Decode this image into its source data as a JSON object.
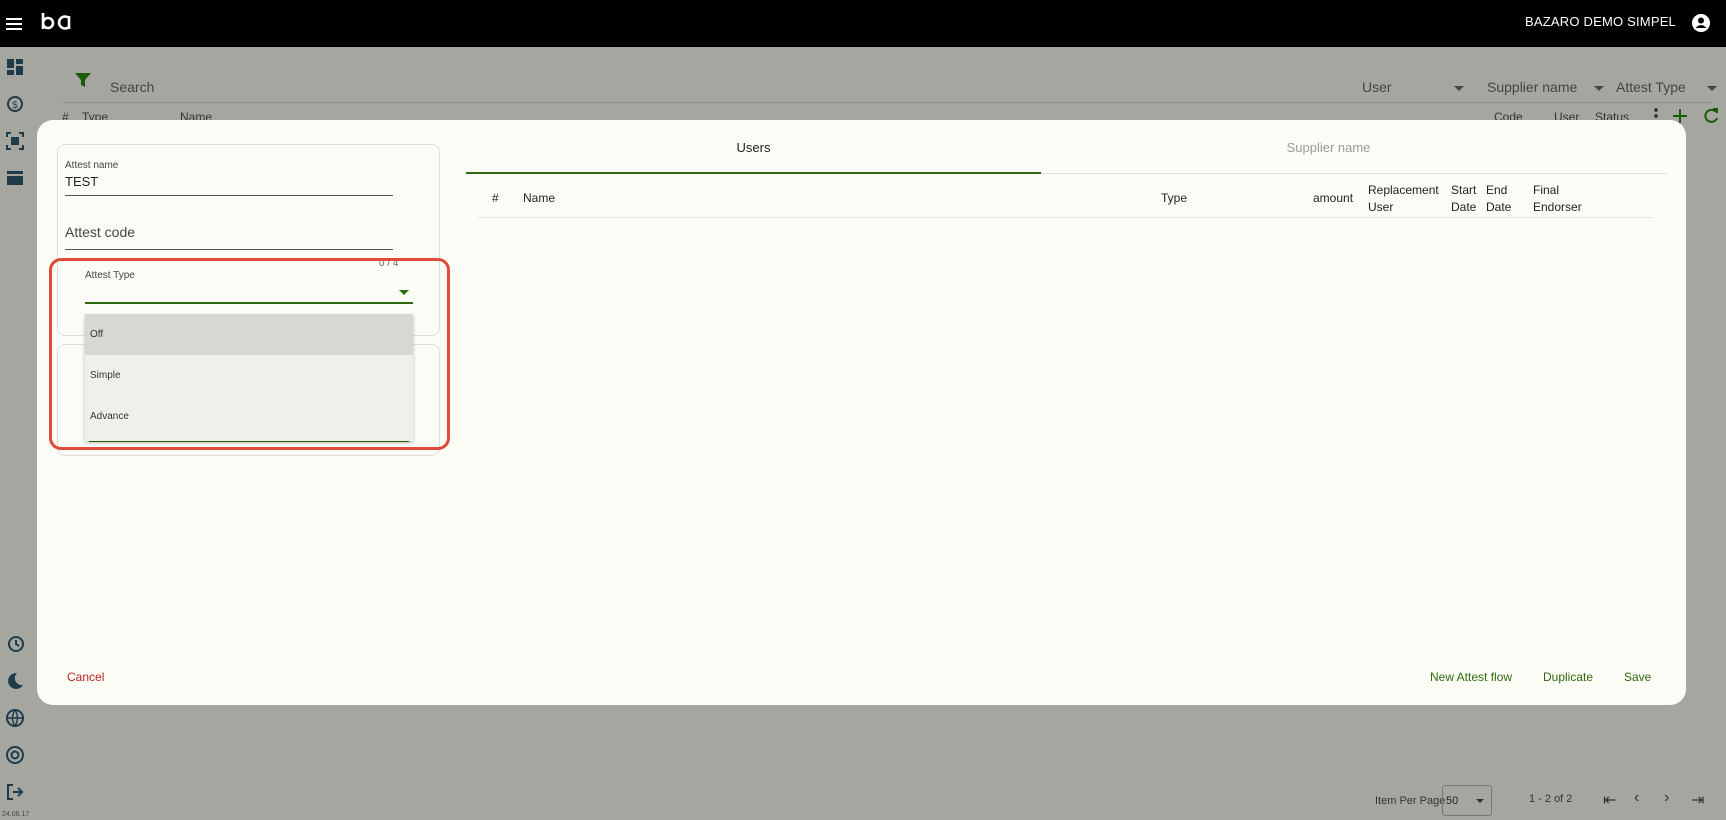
{
  "topbar": {
    "company": "BAZARO DEMO SIMPEL"
  },
  "version": "24.06.17",
  "background": {
    "search_label": "Search",
    "filters": [
      {
        "label": "User"
      },
      {
        "label": "Supplier name"
      },
      {
        "label": "Attest Type"
      }
    ],
    "table_headers": [
      "#",
      "Type",
      "Name",
      "Code",
      "User",
      "Status"
    ],
    "pager": {
      "items_per_page_label": "Item Per Page",
      "items_per_page": "50",
      "range": "1 - 2 of 2"
    }
  },
  "modal": {
    "attest_name": {
      "label": "Attest name",
      "value": "TEST"
    },
    "attest_code": {
      "placeholder": "Attest code"
    },
    "counter": "0 / 4",
    "attest_type": {
      "label": "Attest Type",
      "options": [
        "Off",
        "Simple",
        "Advance"
      ],
      "selected_index": 0
    },
    "tabs": [
      {
        "label": "Users",
        "active": true
      },
      {
        "label": "Supplier name",
        "active": false
      }
    ],
    "table_headers": {
      "num": "#",
      "name": "Name",
      "type": "Type",
      "amount": "amount",
      "replacement_user": "Replacement User",
      "start_date": "Start Date",
      "end_date": "End Date",
      "final_endorser": "Final Endorser"
    },
    "buttons": {
      "cancel": "Cancel",
      "new_flow": "New Attest flow",
      "duplicate": "Duplicate",
      "save": "Save"
    }
  },
  "colors": {
    "accent": "#2d6b0e",
    "danger": "#b3261e",
    "highlight": "#e04a3a",
    "topbar": "#000000"
  }
}
